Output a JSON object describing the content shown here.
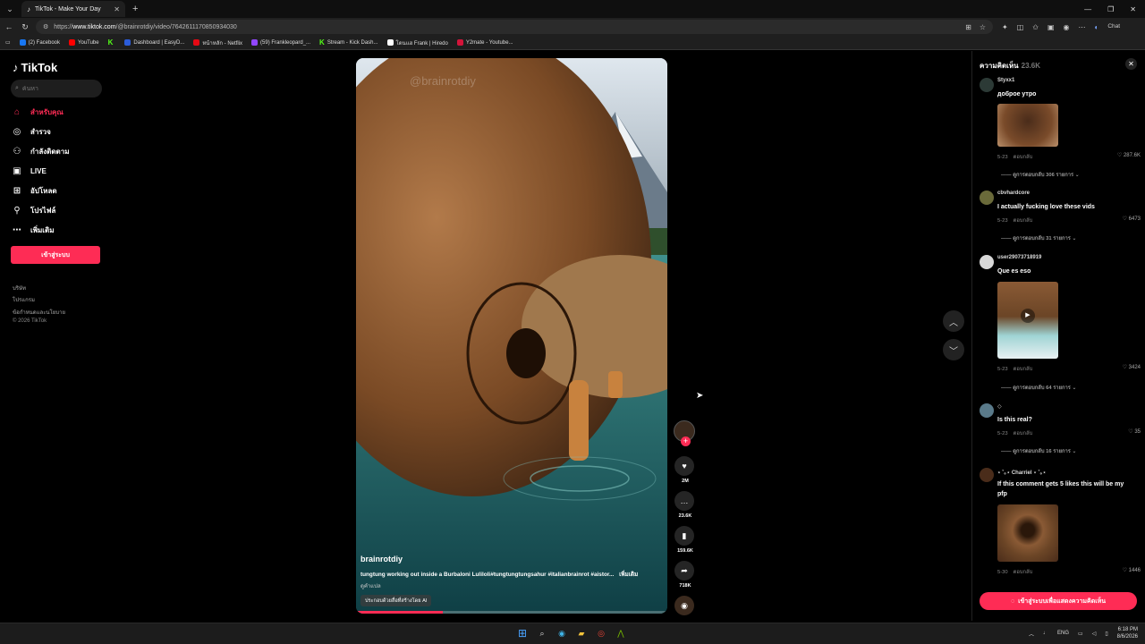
{
  "browser": {
    "tab_title": "TikTok - Make Your Day",
    "url_prefix": "https://",
    "url_domain": "www.tiktok.com",
    "url_path": "/@brainrotdiy/video/7642611170850934030",
    "chat_label": "Chat",
    "bookmarks": [
      {
        "label": "(2) Facebook",
        "color": "#1877f2"
      },
      {
        "label": "YouTube",
        "color": "#ff0000"
      },
      {
        "label": "",
        "color": "#53fc18"
      },
      {
        "label": "Dashboard | EasyD...",
        "color": "#2b5cd9"
      },
      {
        "label": "หน้าหลัก - Netflix",
        "color": "#e50914"
      },
      {
        "label": "(59) Frankleopard_...",
        "color": "#9146ff"
      },
      {
        "label": "Stream - Kick Dash...",
        "color": "#53fc18"
      },
      {
        "label": "โดนแฮ Frank | Hiredo",
        "color": "#ffffff"
      },
      {
        "label": "Y2mate - Youtube...",
        "color": "#d3143a"
      }
    ]
  },
  "sidebar": {
    "logo": "TikTok",
    "search_placeholder": "ค้นหา",
    "nav": [
      {
        "label": "สำหรับคุณ",
        "icon": "home-icon"
      },
      {
        "label": "สำรวจ",
        "icon": "compass-icon"
      },
      {
        "label": "กำลังติดตาม",
        "icon": "following-icon"
      },
      {
        "label": "LIVE",
        "icon": "live-icon"
      },
      {
        "label": "อัปโหลด",
        "icon": "upload-icon"
      },
      {
        "label": "โปรไฟล์",
        "icon": "profile-icon"
      },
      {
        "label": "เพิ่มเติม",
        "icon": "more-icon"
      }
    ],
    "login": "เข้าสู่ระบบ",
    "footer": [
      "บริษัท",
      "โปรแกรม",
      "ข้อกำหนดและนโยบาย",
      "© 2026 TikTok"
    ]
  },
  "video": {
    "watermark": "@brainrotdiy",
    "author": "brainrotdiy",
    "description": "tungtung working out inside a Burbaloni Luliloli#tungtungtungsahur #italianbrainrot #aistor...",
    "more": "เพิ่มเติม",
    "translation": "ดูคำแปล",
    "ai_label": "ประกอบด้วยสื่อที่สร้างโดย AI",
    "progress": 0.28,
    "likes": "2M",
    "comments": "23.6K",
    "saves": "159.6K",
    "shares": "718K"
  },
  "comments_panel": {
    "title": "ความคิดเห็น",
    "count": "23.6K",
    "login_prompt": "เข้าสู่ระบบเพื่อแสดงความคิดเห็น",
    "items": [
      {
        "user": "Styxx1",
        "text": "доброе утро",
        "date": "5-23",
        "reply": "ตอบกลับ",
        "likes": "287.6K",
        "replies": "ดูการตอบกลับ 306 รายการ"
      },
      {
        "user": "cbvhardcore",
        "text": "I actually fucking love these vids",
        "date": "5-23",
        "reply": "ตอบกลับ",
        "likes": "6473",
        "replies": "ดูการตอบกลับ 31 รายการ"
      },
      {
        "user": "user29073718919",
        "text": "Que es eso",
        "date": "5-23",
        "reply": "ตอบกลับ",
        "likes": "3424",
        "replies": "ดูการตอบกลับ 64 รายการ"
      },
      {
        "user": "◇",
        "text": "Is this real?",
        "date": "5-23",
        "reply": "ตอบกลับ",
        "likes": "35",
        "replies": "ดูการตอบกลับ 16 รายการ"
      },
      {
        "user": "⋆ ˚｡⋆ Charriel ⋆ ˚｡⋆",
        "text": "If this comment gets 5 likes this will be my pfp",
        "date": "5-30",
        "reply": "ตอบกลับ",
        "likes": "1446",
        "replies": ""
      }
    ]
  },
  "taskbar": {
    "lang": "ENG",
    "time": "6:18 PM",
    "date": "8/6/2026"
  }
}
